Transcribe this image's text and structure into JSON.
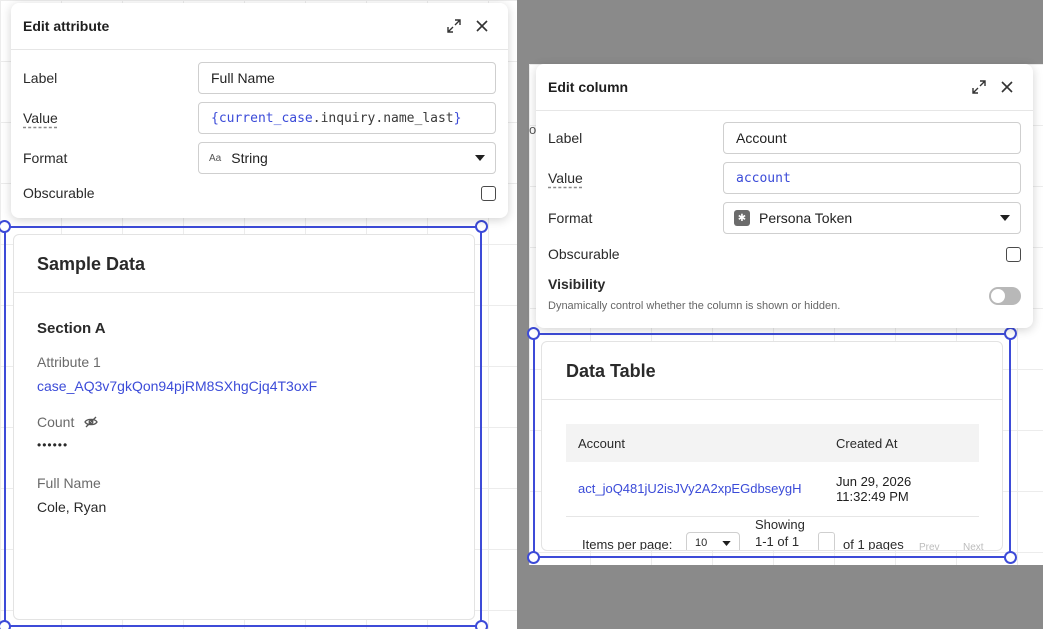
{
  "edit_attribute": {
    "title": "Edit attribute",
    "label_field": {
      "label": "Label",
      "value": "Full Name"
    },
    "value_field": {
      "label": "Value",
      "prefix": "{current_case",
      "dot": ".",
      "middle": "inquiry.name_last",
      "suffix": "}"
    },
    "format_field": {
      "label": "Format",
      "type_icon": "Aa",
      "value": "String"
    },
    "obscurable": {
      "label": "Obscurable",
      "checked": false
    }
  },
  "sample_card": {
    "title": "Sample Data",
    "section": "Section A",
    "attribute1": {
      "label": "Attribute 1",
      "value": "case_AQ3v7gkQon94pjRM8SXhgCjq4T3oxF"
    },
    "count": {
      "label": "Count",
      "value": "••••••"
    },
    "full_name": {
      "label": "Full Name",
      "value": "Cole, Ryan"
    }
  },
  "edit_column": {
    "title": "Edit column",
    "label_field": {
      "label": "Label",
      "value": "Account"
    },
    "value_field": {
      "label": "Value",
      "value": "account"
    },
    "format_field": {
      "label": "Format",
      "value": "Persona Token"
    },
    "obscurable": {
      "label": "Obscurable",
      "checked": false
    },
    "visibility": {
      "label": "Visibility",
      "description": "Dynamically control whether the column is shown or hidden.",
      "on": false
    }
  },
  "data_table": {
    "title": "Data Table",
    "columns": [
      "Account",
      "Created At"
    ],
    "rows": [
      {
        "account": "act_joQ481jU2isJVy2A2xpEGdbseygH",
        "created_date": "Jun 29, 2026",
        "created_time": "11:32:49 PM"
      }
    ],
    "pager": {
      "items_per_page_label": "Items per page:",
      "items_per_page": "10",
      "showing_line1": "Showing",
      "showing_line2": "1-1 of 1",
      "page_suffix": "of 1 pages",
      "prev": "Prev",
      "next": "Next"
    }
  },
  "stray_char": "o",
  "colors": {
    "accent": "#3d4bd8",
    "link": "#3b4bd8",
    "gray_backdrop": "#8a8a8a"
  }
}
